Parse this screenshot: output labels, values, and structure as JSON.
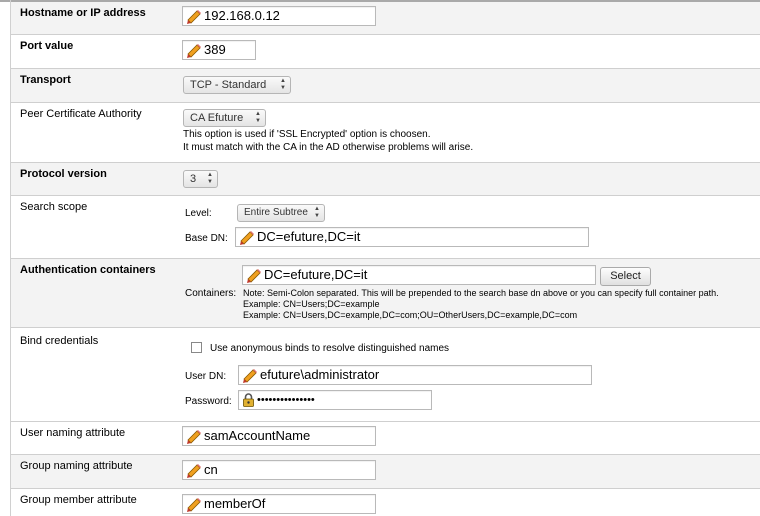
{
  "hostname": {
    "label": "Hostname or IP address",
    "value": "192.168.0.12"
  },
  "port": {
    "label": "Port value",
    "value": "389"
  },
  "transport": {
    "label": "Transport",
    "selected": "TCP - Standard"
  },
  "peer_ca": {
    "label": "Peer Certificate Authority",
    "selected": "CA Efuture",
    "help_line1": "This option is used if 'SSL Encrypted' option is choosen.",
    "help_line2": "It must match with the CA in the AD otherwise problems will arise."
  },
  "protocol": {
    "label": "Protocol version",
    "selected": "3"
  },
  "search_scope": {
    "label": "Search scope",
    "level_label": "Level:",
    "level_selected": "Entire Subtree",
    "base_dn_label": "Base DN:",
    "base_dn_value": "DC=efuture,DC=it"
  },
  "auth_containers": {
    "label": "Authentication containers",
    "value": "DC=efuture,DC=it",
    "select_button": "Select",
    "containers_label": "Containers:",
    "note1": "Note: Semi-Colon separated. This will be prepended to the search base dn above or you can specify full container path.",
    "note2": "Example: CN=Users;DC=example",
    "note3": "Example: CN=Users,DC=example,DC=com;OU=OtherUsers,DC=example,DC=com"
  },
  "bind": {
    "label": "Bind credentials",
    "anon_label": "Use anonymous binds to resolve distinguished names",
    "user_dn_label": "User DN:",
    "user_dn_value": "efuture\\administrator",
    "password_label": "Password:",
    "password_value": "•••••••••••••••"
  },
  "user_naming": {
    "label": "User naming attribute",
    "value": "samAccountName"
  },
  "group_naming": {
    "label": "Group naming attribute",
    "value": "cn"
  },
  "group_member": {
    "label": "Group member attribute",
    "value": "memberOf"
  },
  "colors": {
    "row_shade": "#f3f3f3",
    "border": "#cfcfcf",
    "pencil": "#f0a020",
    "pencil_tip": "#c0392b"
  },
  "icons": {
    "field": "pencil-icon",
    "password": "lock-icon",
    "dropdown": "updown-arrows-icon"
  }
}
